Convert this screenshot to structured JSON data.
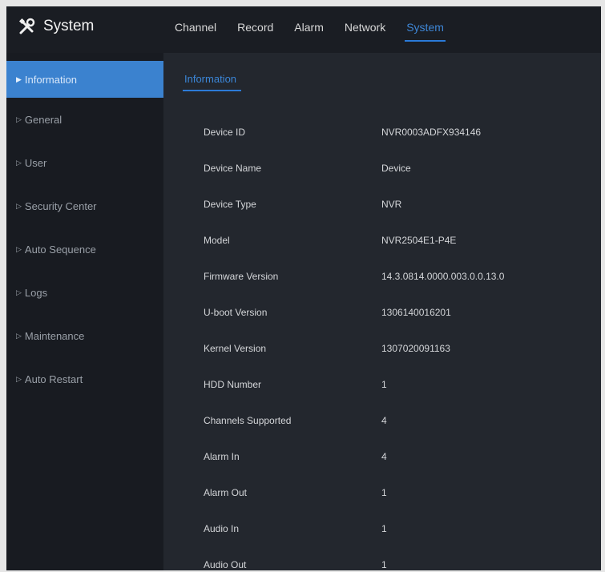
{
  "app": {
    "title": "System"
  },
  "nav": {
    "items": [
      {
        "label": "Channel"
      },
      {
        "label": "Record"
      },
      {
        "label": "Alarm"
      },
      {
        "label": "Network"
      },
      {
        "label": "System"
      }
    ],
    "active_index": 4
  },
  "sidebar": {
    "items": [
      {
        "label": "Information"
      },
      {
        "label": "General"
      },
      {
        "label": "User"
      },
      {
        "label": "Security Center"
      },
      {
        "label": "Auto Sequence"
      },
      {
        "label": "Logs"
      },
      {
        "label": "Maintenance"
      },
      {
        "label": "Auto Restart"
      }
    ],
    "active_index": 0
  },
  "main": {
    "tab_label": "Information",
    "rows": [
      {
        "key": "Device ID",
        "value": "NVR0003ADFX934146"
      },
      {
        "key": "Device Name",
        "value": "Device"
      },
      {
        "key": "Device Type",
        "value": "NVR"
      },
      {
        "key": "Model",
        "value": "NVR2504E1-P4E"
      },
      {
        "key": "Firmware Version",
        "value": "14.3.0814.0000.003.0.0.13.0"
      },
      {
        "key": "U-boot Version",
        "value": "1306140016201"
      },
      {
        "key": "Kernel Version",
        "value": "1307020091163"
      },
      {
        "key": "HDD Number",
        "value": "1"
      },
      {
        "key": "Channels Supported",
        "value": "4"
      },
      {
        "key": "Alarm In",
        "value": "4"
      },
      {
        "key": "Alarm Out",
        "value": "1"
      },
      {
        "key": "Audio In",
        "value": "1"
      },
      {
        "key": "Audio Out",
        "value": "1"
      }
    ]
  },
  "colors": {
    "accent": "#3b82cf",
    "background": "#23272e",
    "sidebar": "#181b21"
  },
  "icons": {
    "title_icon": "tools-icon",
    "sidebar_marker": "triangle-right-icon"
  }
}
